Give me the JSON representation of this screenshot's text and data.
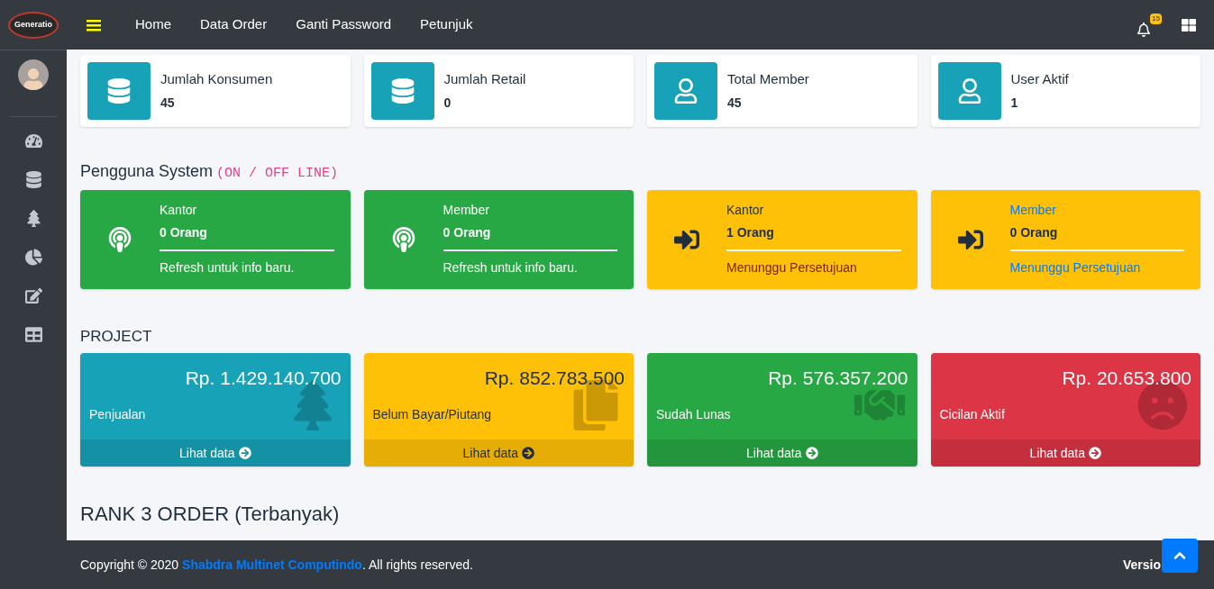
{
  "brand": {
    "logo_text": "Generatio"
  },
  "nav": {
    "items": [
      "Home",
      "Data Order",
      "Ganti Password",
      "Petunjuk"
    ],
    "notification_count": "15"
  },
  "info_boxes": [
    {
      "kind": "data",
      "label": "Jumlah Konsumen",
      "value": "45"
    },
    {
      "kind": "data",
      "label": "Jumlah Retail",
      "value": "0"
    },
    {
      "kind": "person",
      "label": "Total Member",
      "value": "45"
    },
    {
      "kind": "person",
      "label": "User Aktif",
      "value": "1"
    }
  ],
  "users_section": {
    "title": "Pengguna System",
    "code": "(ON / OFF LINE)"
  },
  "status_cards": [
    {
      "kind": "online",
      "color": "#28a745",
      "title": "Kantor",
      "count": "0 Orang",
      "note": "Refresh untuk info baru."
    },
    {
      "kind": "online",
      "color": "#28a745",
      "title": "Member",
      "count": "0 Orang",
      "note": "Refresh untuk info baru."
    },
    {
      "kind": "pending",
      "color": "#ffc107",
      "title": "Kantor",
      "count": "1 Orang",
      "note": "Menunggu Persetujuan"
    },
    {
      "kind": "request",
      "color": "#ffc107",
      "title": "Member",
      "count": "0 Orang",
      "note": "Menunggu Persetujuan"
    }
  ],
  "project_section": {
    "title": "PROJECT"
  },
  "project_cards": [
    {
      "kind": "sales",
      "color": "#17a2b8",
      "amount": "Rp. 1.429.140.700",
      "label": "Penjualan",
      "link": "Lihat data"
    },
    {
      "kind": "receivable",
      "color": "#ffc107",
      "amount": "Rp. 852.783.500",
      "label": "Belum Bayar/Piutang",
      "link": "Lihat data"
    },
    {
      "kind": "paid",
      "color": "#28a745",
      "amount": "Rp. 576.357.200",
      "label": "Sudah Lunas",
      "link": "Lihat data"
    },
    {
      "kind": "installment",
      "color": "#dc3545",
      "amount": "Rp. 20.653.800",
      "label": "Cicilan Aktif",
      "link": "Lihat data"
    }
  ],
  "rank_section": {
    "title": "RANK 3 ORDER (Terbanyak)"
  },
  "footer": {
    "copyright": "Copyright © 2020",
    "company": "Shabdra Multinet Computindo",
    "rights": ". All rights reserved.",
    "version": "Versio"
  }
}
